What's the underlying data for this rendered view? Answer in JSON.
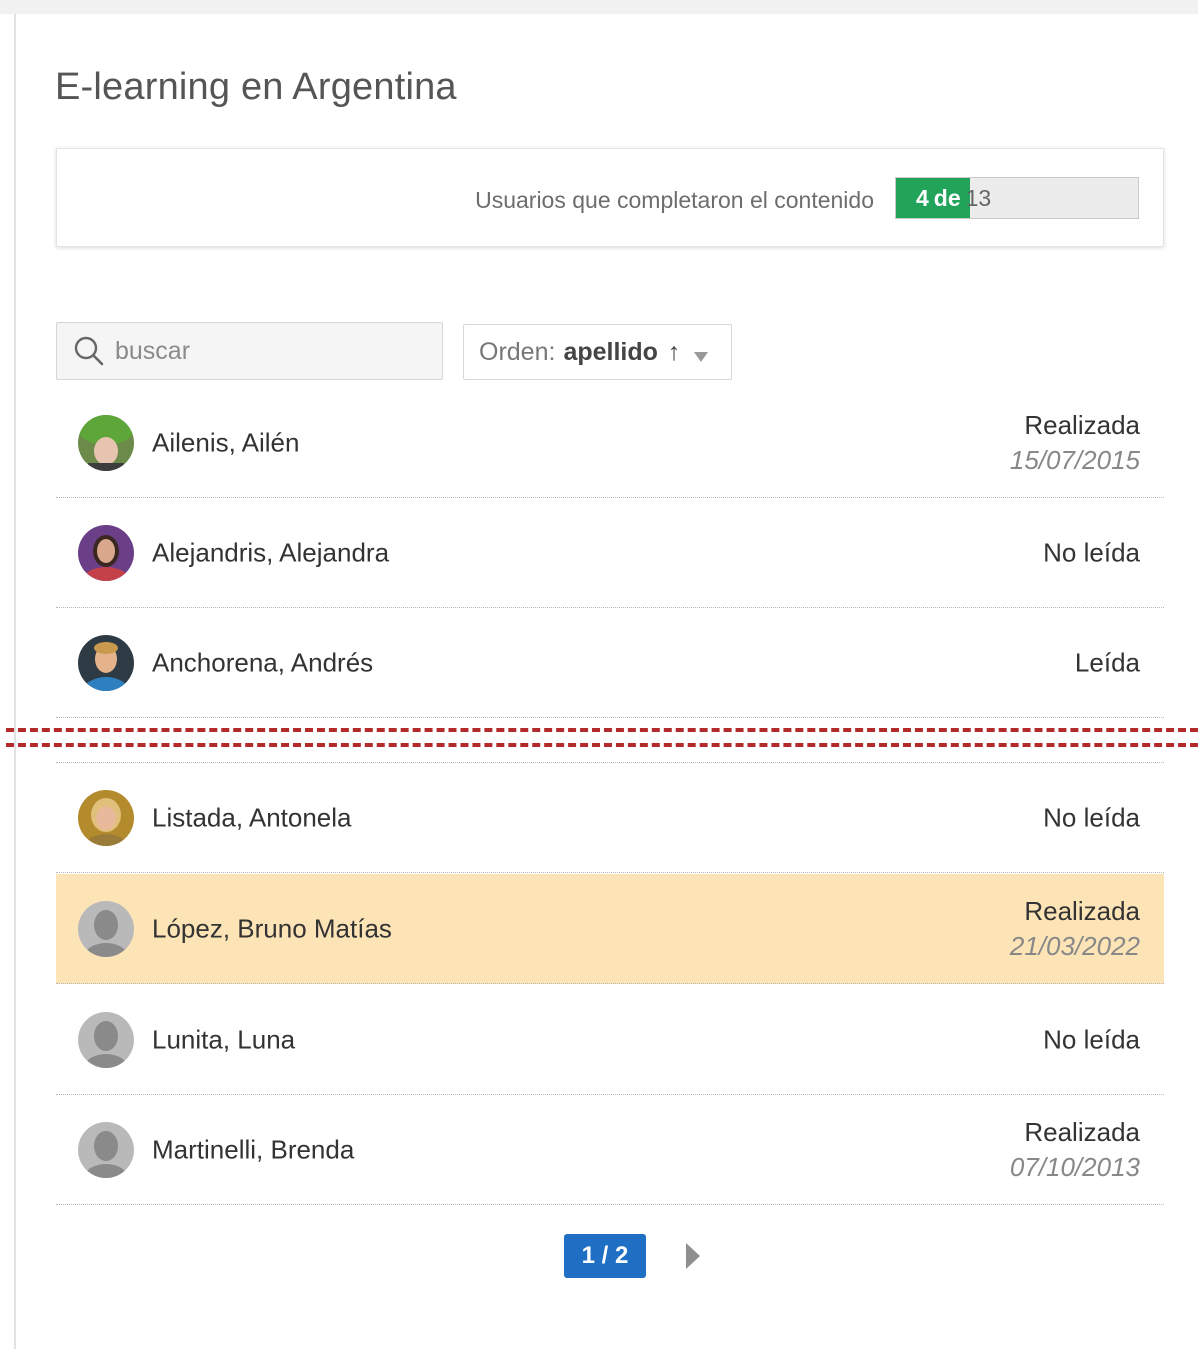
{
  "title": "E-learning en Argentina",
  "stats": {
    "label": "Usuarios que completaron el contenido",
    "completed": "4",
    "separator": "de",
    "total": "13",
    "completion_fraction": 0.3077,
    "fill_color": "#22a35a"
  },
  "search": {
    "placeholder": "buscar",
    "icon": "search-icon"
  },
  "order": {
    "prefix": "Orden:",
    "field": "apellido",
    "direction": "↑",
    "icon": "caret-down-icon"
  },
  "users": [
    {
      "name": "Ailenis, Ailén",
      "status": "Realizada",
      "date": "15/07/2015",
      "avatar": "photo-green-hat",
      "highlighted": false
    },
    {
      "name": "Alejandris, Alejandra",
      "status": "No leída",
      "date": "",
      "avatar": "photo-woman-dark-hair",
      "highlighted": false
    },
    {
      "name": "Anchorena, Andrés",
      "status": "Leída",
      "date": "",
      "avatar": "photo-man-blond",
      "highlighted": false
    },
    {
      "name": "Listada, Antonela",
      "status": "No leída",
      "date": "",
      "avatar": "photo-woman-blonde",
      "highlighted": false
    },
    {
      "name": "López, Bruno Matías",
      "status": "Realizada",
      "date": "21/03/2022",
      "avatar": "default-avatar",
      "highlighted": true
    },
    {
      "name": "Lunita, Luna",
      "status": "No leída",
      "date": "",
      "avatar": "default-avatar",
      "highlighted": false
    },
    {
      "name": "Martinelli, Brenda",
      "status": "Realizada",
      "date": "07/10/2013",
      "avatar": "default-avatar",
      "highlighted": false
    }
  ],
  "pagination": {
    "label": "1 / 2",
    "next_icon": "next-arrow-icon"
  },
  "colors": {
    "highlight": "#fde4b7",
    "pager": "#1f6fc5",
    "cut_line": "#b22a2a"
  }
}
